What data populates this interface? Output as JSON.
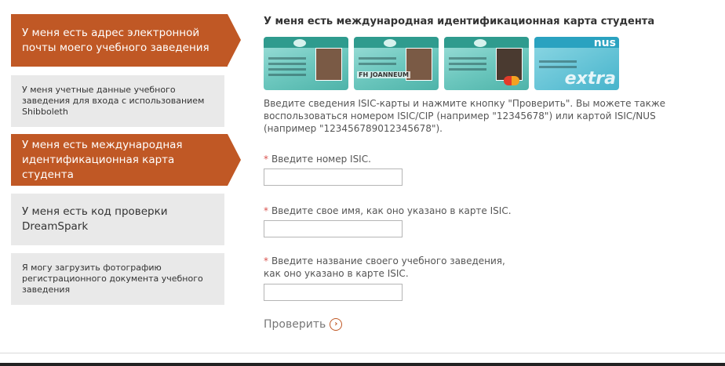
{
  "sidebar": {
    "items": [
      {
        "label": "У меня есть адрес электронной почты моего учебного заведения"
      },
      {
        "label": "У меня учетные данные учебного заведения для входа с использованием Shibboleth"
      },
      {
        "label": "У меня есть международная идентификационная карта студента"
      },
      {
        "label": "У меня есть код проверки DreamSpark"
      },
      {
        "label": "Я могу загрузить фотографию регистрационного документа учебного заведения"
      }
    ]
  },
  "main": {
    "heading": "У меня есть международная идентификационная карта студента",
    "cards": [
      {
        "name": "isic-card-1"
      },
      {
        "name": "isic-card-2",
        "brand": "FH JOANNEUM"
      },
      {
        "name": "isic-card-3"
      },
      {
        "name": "isic-card-4",
        "logo": "nus",
        "watermark": "extra"
      }
    ],
    "description": "Введите сведения ISIC-карты и нажмите кнопку \"Проверить\". Вы можете также воспользоваться номером ISIC/CIP (например \"12345678\") или картой ISIC/NUS (например \"123456789012345678\").",
    "required_mark": "*",
    "fields": [
      {
        "label": "Введите номер ISIC.",
        "value": ""
      },
      {
        "label": "Введите свое имя, как оно указано в карте ISIC.",
        "value": ""
      },
      {
        "label": "Введите название своего учебного заведения, как оно указано в карте ISIC.",
        "value": ""
      }
    ],
    "submit_label": "Проверить"
  },
  "colors": {
    "accent": "#c05825",
    "inactive_tab": "#e9e9e9",
    "required": "#d9534f"
  }
}
